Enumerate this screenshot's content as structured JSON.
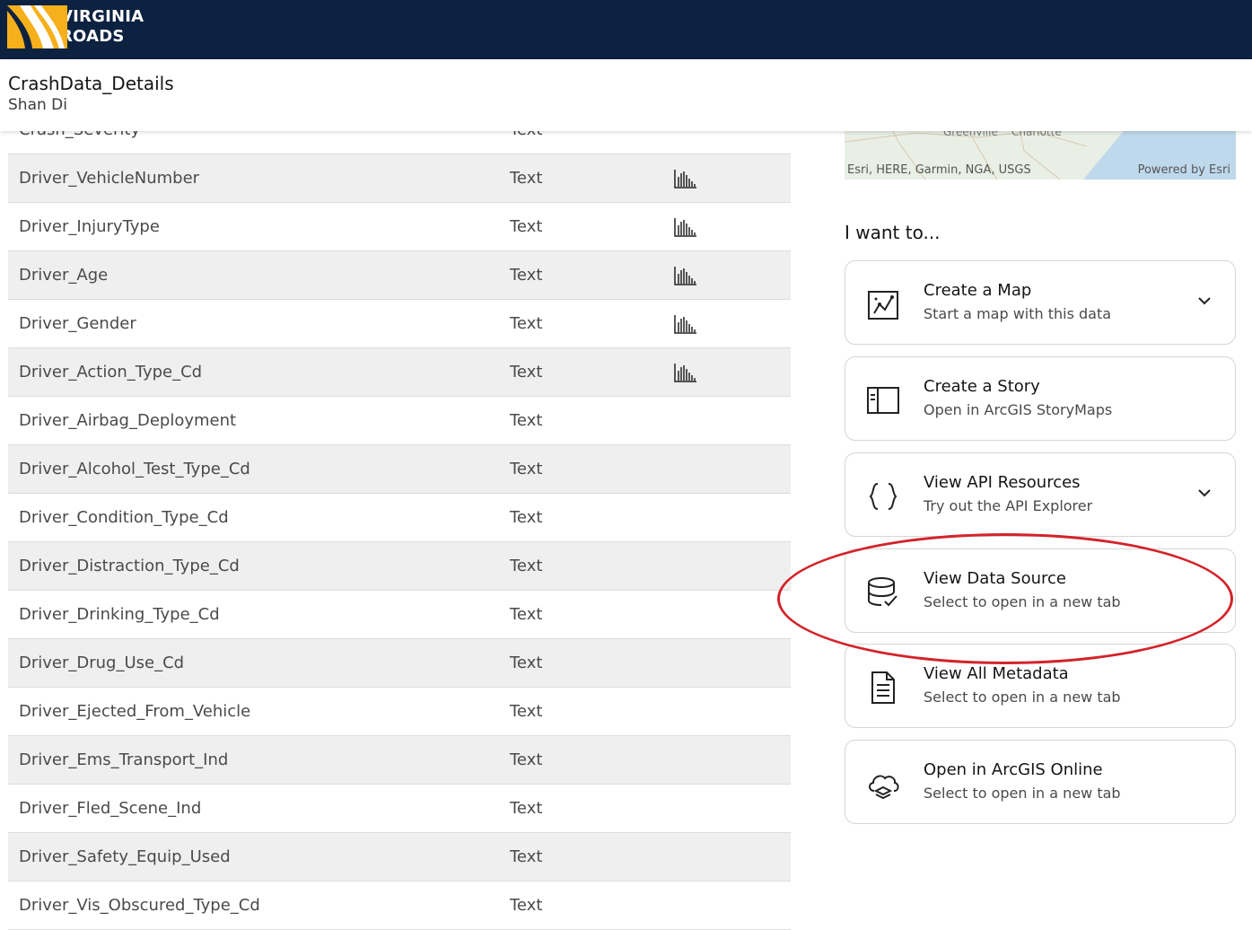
{
  "header": {
    "logo_line1": "VIRGINIA",
    "logo_line2": "ROADS"
  },
  "page": {
    "title": "CrashData_Details",
    "owner": "Shan Di"
  },
  "fields": [
    {
      "name": "Crash_Severity",
      "type": "Text",
      "chart": false
    },
    {
      "name": "Driver_VehicleNumber",
      "type": "Text",
      "chart": true
    },
    {
      "name": "Driver_InjuryType",
      "type": "Text",
      "chart": true
    },
    {
      "name": "Driver_Age",
      "type": "Text",
      "chart": true
    },
    {
      "name": "Driver_Gender",
      "type": "Text",
      "chart": true
    },
    {
      "name": "Driver_Action_Type_Cd",
      "type": "Text",
      "chart": true
    },
    {
      "name": "Driver_Airbag_Deployment",
      "type": "Text",
      "chart": false
    },
    {
      "name": "Driver_Alcohol_Test_Type_Cd",
      "type": "Text",
      "chart": false
    },
    {
      "name": "Driver_Condition_Type_Cd",
      "type": "Text",
      "chart": false
    },
    {
      "name": "Driver_Distraction_Type_Cd",
      "type": "Text",
      "chart": false
    },
    {
      "name": "Driver_Drinking_Type_Cd",
      "type": "Text",
      "chart": false
    },
    {
      "name": "Driver_Drug_Use_Cd",
      "type": "Text",
      "chart": false
    },
    {
      "name": "Driver_Ejected_From_Vehicle",
      "type": "Text",
      "chart": false
    },
    {
      "name": "Driver_Ems_Transport_Ind",
      "type": "Text",
      "chart": false
    },
    {
      "name": "Driver_Fled_Scene_Ind",
      "type": "Text",
      "chart": false
    },
    {
      "name": "Driver_Safety_Equip_Used",
      "type": "Text",
      "chart": false
    },
    {
      "name": "Driver_Vis_Obscured_Type_Cd",
      "type": "Text",
      "chart": false
    }
  ],
  "map": {
    "city1": "Greenville",
    "city2": "Charlotte",
    "attribution": "Esri, HERE, Garmin, NGA, USGS",
    "powered_by": "Powered by Esri"
  },
  "actions": {
    "heading": "I want to...",
    "items": [
      {
        "title": "Create a Map",
        "subtitle": "Start a map with this data",
        "icon": "map-icon",
        "expandable": true
      },
      {
        "title": "Create a Story",
        "subtitle": "Open in ArcGIS StoryMaps",
        "icon": "story-icon",
        "expandable": false
      },
      {
        "title": "View API Resources",
        "subtitle": "Try out the API Explorer",
        "icon": "curly-braces-icon",
        "expandable": true
      },
      {
        "title": "View Data Source",
        "subtitle": "Select to open in a new tab",
        "icon": "database-check-icon",
        "expandable": false
      },
      {
        "title": "View All Metadata",
        "subtitle": "Select to open in a new tab",
        "icon": "document-icon",
        "expandable": false
      },
      {
        "title": "Open in ArcGIS Online",
        "subtitle": "Select to open in a new tab",
        "icon": "cloud-layers-icon",
        "expandable": false
      }
    ]
  },
  "colors": {
    "header_bg": "#0d2240",
    "logo_accent": "#f6b01b",
    "highlight": "#d3232a"
  }
}
